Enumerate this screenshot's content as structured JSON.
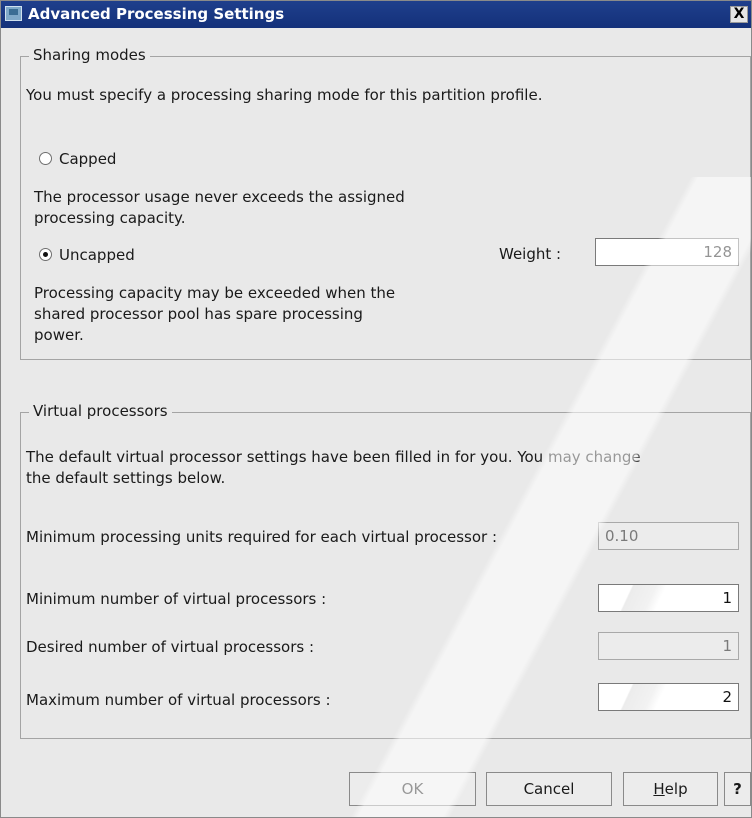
{
  "window": {
    "title": "Advanced Processing Settings",
    "close_symbol": "X"
  },
  "sharing": {
    "legend": "Sharing modes",
    "instruction": "You must specify a processing sharing mode for this partition profile.",
    "capped": {
      "label": "Capped",
      "selected": false,
      "description_line1": "The processor usage never exceeds the assigned",
      "description_line2": "processing capacity."
    },
    "uncapped": {
      "label": "Uncapped",
      "selected": true,
      "description_line1": "Processing capacity may be exceeded when the",
      "description_line2": "shared processor pool has spare processing",
      "description_line3": "power."
    },
    "weight": {
      "label": "Weight :",
      "value": "128"
    }
  },
  "virtual": {
    "legend": "Virtual processors",
    "description_line1": "The default virtual processor settings have been filled in for you. You may change",
    "description_line2": "the default settings below.",
    "min_units": {
      "label": "Minimum processing units required for each virtual processor :",
      "value": "0.10"
    },
    "min_vp": {
      "label": "Minimum number of virtual processors :",
      "value": "1"
    },
    "desired_vp": {
      "label": "Desired number of virtual processors :",
      "value": "1"
    },
    "max_vp": {
      "label": "Maximum number of virtual processors :",
      "value": "2"
    }
  },
  "buttons": {
    "ok": "OK",
    "cancel": "Cancel",
    "help_mnemonic": "H",
    "help_rest": "elp",
    "context_help": "?"
  }
}
